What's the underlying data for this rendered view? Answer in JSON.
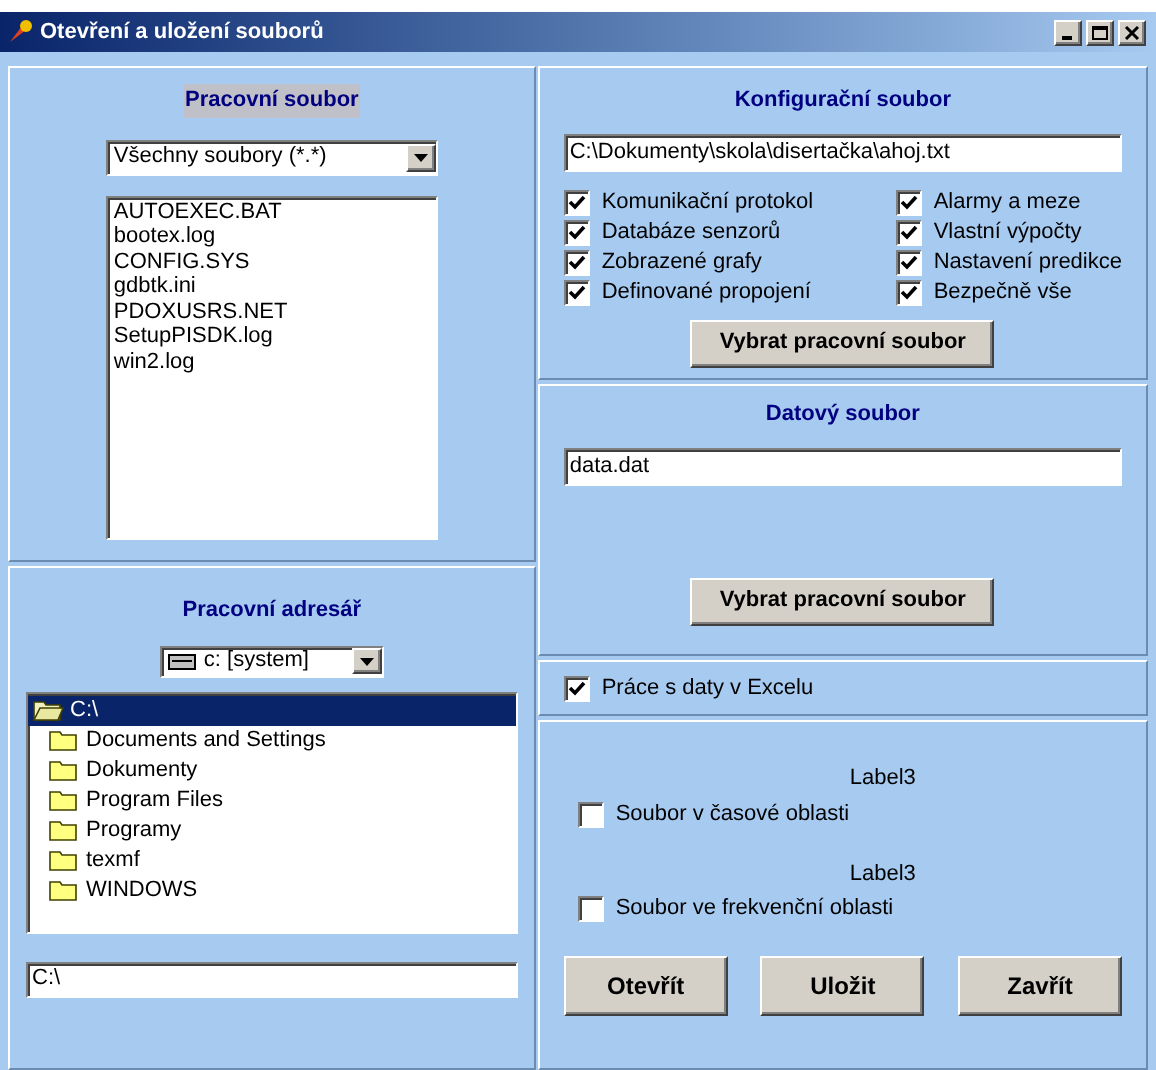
{
  "window": {
    "title": "Otevření a uložení souborů"
  },
  "working_file": {
    "heading": "Pracovní soubor",
    "filter": "Všechny soubory (*.*)",
    "files": [
      "AUTOEXEC.BAT",
      "bootex.log",
      "CONFIG.SYS",
      "gdbtk.ini",
      "PDOXUSRS.NET",
      "SetupPISDK.log",
      "win2.log"
    ]
  },
  "working_dir": {
    "heading": "Pracovní adresář",
    "drive": "c: [system]",
    "folders": [
      {
        "name": "C:\\",
        "selected": true,
        "expanded": true
      },
      {
        "name": "Documents and Settings",
        "selected": false,
        "expanded": false
      },
      {
        "name": "Dokumenty",
        "selected": false,
        "expanded": false
      },
      {
        "name": "Program Files",
        "selected": false,
        "expanded": false
      },
      {
        "name": "Programy",
        "selected": false,
        "expanded": false
      },
      {
        "name": "texmf",
        "selected": false,
        "expanded": false
      },
      {
        "name": "WINDOWS",
        "selected": false,
        "expanded": false
      }
    ],
    "path": "C:\\"
  },
  "config_file": {
    "heading": "Konfigurační soubor",
    "path": "C:\\Dokumenty\\skola\\disertačka\\ahoj.txt",
    "options": [
      {
        "label": "Komunikační protokol",
        "checked": true
      },
      {
        "label": "Databáze senzorů",
        "checked": true
      },
      {
        "label": "Zobrazené grafy",
        "checked": true
      },
      {
        "label": "Definované propojení",
        "checked": true
      },
      {
        "label": "Alarmy a meze",
        "checked": true
      },
      {
        "label": "Vlastní výpočty",
        "checked": true
      },
      {
        "label": "Nastavení predikce",
        "checked": true
      },
      {
        "label": "Bezpečně vše",
        "checked": true
      }
    ],
    "button": "Vybrat pracovní soubor"
  },
  "data_file": {
    "heading": "Datový soubor",
    "value": "data.dat",
    "button": "Vybrat pracovní soubor"
  },
  "excel": {
    "label": "Práce s daty v Excelu",
    "checked": true
  },
  "domains": [
    {
      "caption": "Label3",
      "label": "Soubor v časové oblasti",
      "checked": false
    },
    {
      "caption": "Label3",
      "label": "Soubor ve frekvenční oblasti",
      "checked": false
    }
  ],
  "buttons": [
    "Otevřít",
    "Uložit",
    "Zavřít"
  ]
}
